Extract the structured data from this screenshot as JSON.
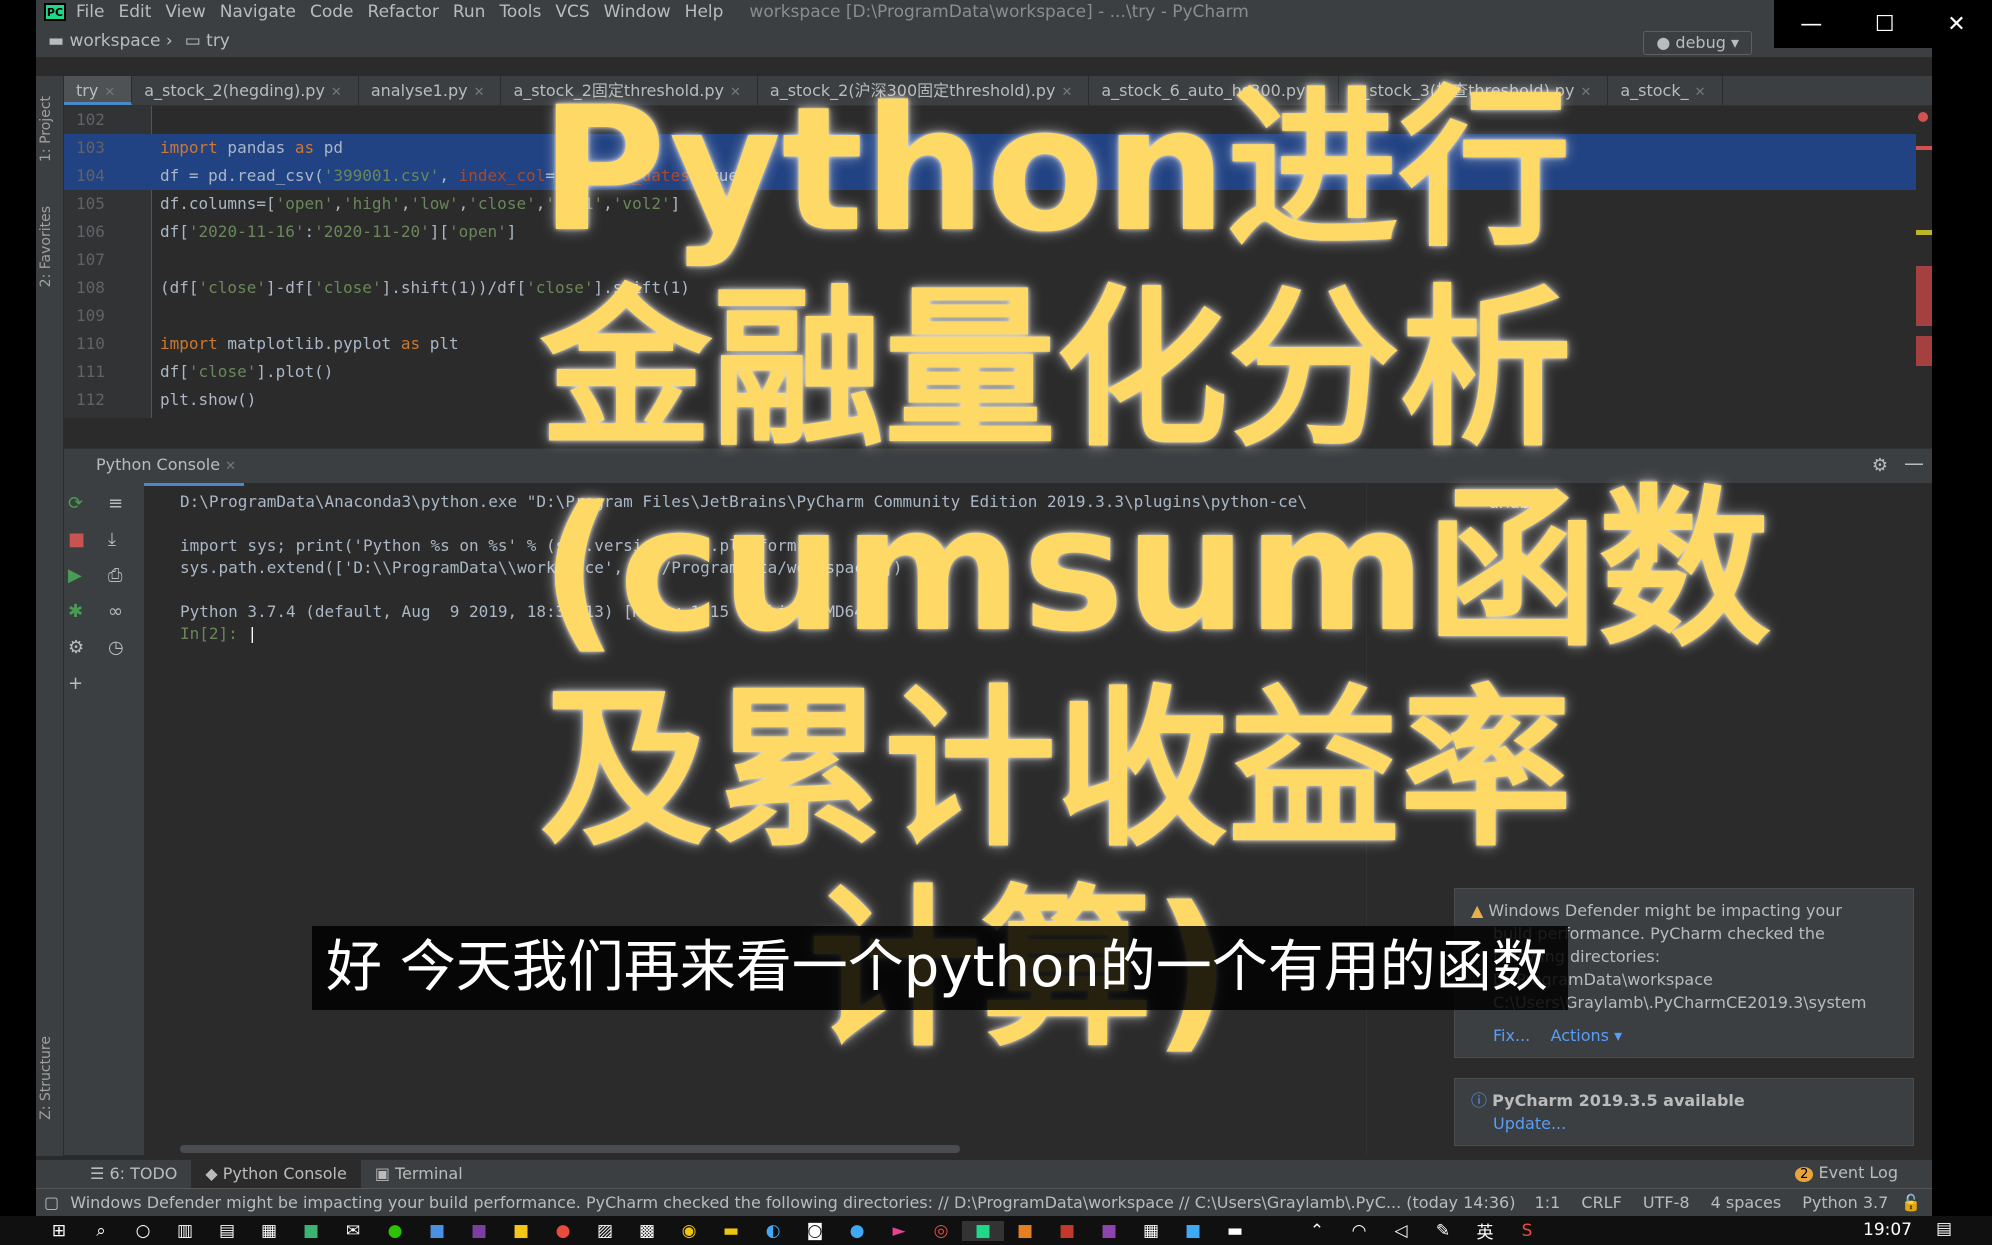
{
  "menubar": {
    "items": [
      "File",
      "Edit",
      "View",
      "Navigate",
      "Code",
      "Refactor",
      "Run",
      "Tools",
      "VCS",
      "Window",
      "Help"
    ],
    "title": "workspace [D:\\ProgramData\\workspace] - ...\\try - PyCharm"
  },
  "navbar": {
    "crumb1": "workspace",
    "crumb2": "try",
    "run_config": "debug"
  },
  "tabs": [
    "try",
    "a_stock_2(hegding).py",
    "analyse1.py",
    "a_stock_2固定threshold.py",
    "a_stock_2(沪深300固定threshold).py",
    "a_stock_6_auto_hs300.py",
    "a_stock_3(检查threshold).py",
    "a_stock_"
  ],
  "side_tabs": {
    "project": "1: Project",
    "favorites": "2: Favorites",
    "structure": "Z: Structure"
  },
  "editor": {
    "lines": [
      {
        "n": "102",
        "parts": []
      },
      {
        "n": "103",
        "parts": [
          {
            "t": "import",
            "c": "kw"
          },
          {
            "t": " pandas ",
            "c": ""
          },
          {
            "t": "as",
            "c": "kw"
          },
          {
            "t": " pd",
            "c": ""
          }
        ],
        "sel": true
      },
      {
        "n": "104",
        "parts": [
          {
            "t": "df = pd.read_csv(",
            "c": ""
          },
          {
            "t": "'399001.csv'",
            "c": "str"
          },
          {
            "t": ", ",
            "c": ""
          },
          {
            "t": "index_col",
            "c": "prm"
          },
          {
            "t": "=0, ",
            "c": ""
          },
          {
            "t": "parse_dates",
            "c": "prm"
          },
          {
            "t": "=True)",
            "c": ""
          }
        ],
        "sel": true
      },
      {
        "n": "105",
        "parts": [
          {
            "t": "df.columns=[",
            "c": ""
          },
          {
            "t": "'open'",
            "c": "str"
          },
          {
            "t": ",",
            "c": ""
          },
          {
            "t": "'high'",
            "c": "str"
          },
          {
            "t": ",",
            "c": ""
          },
          {
            "t": "'low'",
            "c": "str"
          },
          {
            "t": ",",
            "c": ""
          },
          {
            "t": "'close'",
            "c": "str"
          },
          {
            "t": ",",
            "c": ""
          },
          {
            "t": "'vol1'",
            "c": "str"
          },
          {
            "t": ",",
            "c": ""
          },
          {
            "t": "'vol2'",
            "c": "str"
          },
          {
            "t": "]",
            "c": ""
          }
        ]
      },
      {
        "n": "106",
        "parts": [
          {
            "t": "df[",
            "c": ""
          },
          {
            "t": "'2020-11-16'",
            "c": "str"
          },
          {
            "t": ":",
            "c": ""
          },
          {
            "t": "'2020-11-20'",
            "c": "str"
          },
          {
            "t": "][",
            "c": ""
          },
          {
            "t": "'open'",
            "c": "str"
          },
          {
            "t": "]",
            "c": ""
          }
        ]
      },
      {
        "n": "107",
        "parts": []
      },
      {
        "n": "108",
        "parts": [
          {
            "t": "(df[",
            "c": ""
          },
          {
            "t": "'close'",
            "c": "str"
          },
          {
            "t": "]-df[",
            "c": ""
          },
          {
            "t": "'close'",
            "c": "str"
          },
          {
            "t": "].shift(1))/df[",
            "c": ""
          },
          {
            "t": "'close'",
            "c": "str"
          },
          {
            "t": "].shift(1)",
            "c": ""
          }
        ]
      },
      {
        "n": "109",
        "parts": []
      },
      {
        "n": "110",
        "parts": [
          {
            "t": "import",
            "c": "kw"
          },
          {
            "t": " matplotlib.pyplot ",
            "c": ""
          },
          {
            "t": "as",
            "c": "kw"
          },
          {
            "t": " plt",
            "c": ""
          }
        ]
      },
      {
        "n": "111",
        "parts": [
          {
            "t": "df[",
            "c": ""
          },
          {
            "t": "'close'",
            "c": "str"
          },
          {
            "t": "].plot()",
            "c": ""
          }
        ]
      },
      {
        "n": "112",
        "parts": [
          {
            "t": "plt.show()",
            "c": ""
          }
        ]
      }
    ]
  },
  "console": {
    "tab": "Python Console",
    "line1": "D:\\ProgramData\\Anaconda3\\python.exe \"D:\\Program Files\\JetBrains\\PyCharm Community Edition 2019.3.3\\plugins\\python-ce\\",
    "line2": "import sys; print('Python %s on %s' % (sys.version, sys.platform))",
    "line3": "sys.path.extend(['D:\\\\ProgramData\\\\workspace', 'D:/ProgramData/workspace'])",
    "line4": "Python 3.7.4 (default, Aug  9 2019, 18:34:13) [MSC v.1915 64 bit (AMD64)]",
    "prompt": "In[2]:",
    "vars_label": "ariables"
  },
  "notices": {
    "defender_lines": [
      "Windows Defender might be impacting your",
      "build performance. PyCharm checked the",
      "following directories:",
      "D:\\ProgramData\\workspace",
      "C:\\Users\\Graylamb\\.PyCharmCE2019.3\\system"
    ],
    "fix": "Fix...",
    "actions": "Actions ▾",
    "update_title": "PyCharm 2019.3.5 available",
    "update_link": "Update..."
  },
  "bottom_tools": {
    "todo": "6: TODO",
    "console": "Python Console",
    "terminal": "Terminal",
    "event_log": "Event Log",
    "event_count": "2"
  },
  "status": {
    "message": "Windows Defender might be impacting your build performance. PyCharm checked the following directories: // D:\\ProgramData\\workspace // C:\\Users\\Graylamb\\.PyC... (today 14:36)",
    "pos": "1:1",
    "eol": "CRLF",
    "enc": "UTF-8",
    "indent": "4 spaces",
    "interp": "Python 3.7"
  },
  "taskbar": {
    "time": "19:07",
    "ime": "英"
  },
  "overlay": {
    "lines": [
      "Python进行",
      "金融量化分析",
      "(cumsum函数",
      "及累计收益率",
      "计算)"
    ]
  },
  "subtitle": "好 今天我们再来看一个python的一个有用的函数"
}
